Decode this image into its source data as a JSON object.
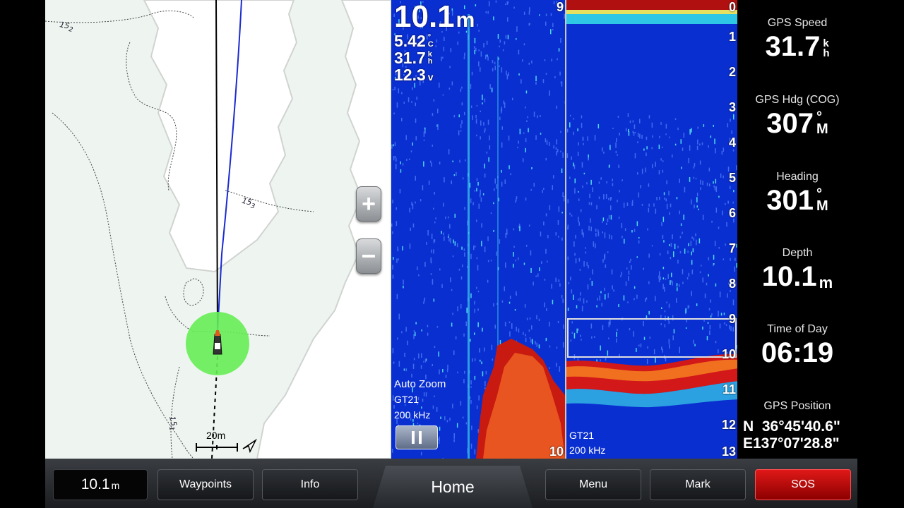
{
  "chart": {
    "contours": [
      "15",
      "15",
      "15"
    ],
    "contour_subs": [
      "2",
      "3",
      "1"
    ],
    "scale_label": "20m",
    "zoom_in_icon": "plus-icon",
    "zoom_out_icon": "minus-icon",
    "colors": {
      "water": "#eef5f0",
      "track": "#1a2bd0",
      "heading_line": "#000000",
      "position_circle": "#66ee55"
    }
  },
  "sonar_left": {
    "depth_value": "10.1",
    "depth_unit": "m",
    "temp_value": "5.42",
    "temp_unit_top": "°",
    "temp_unit_bottom": "C",
    "speed_value": "31.7",
    "speed_unit_top": "k",
    "speed_unit_bottom": "h",
    "voltage_value": "12.3",
    "voltage_unit": "v",
    "top_scale": "9",
    "bottom_scale": "10",
    "mode_label": "Auto Zoom",
    "transducer": "GT21",
    "frequency": "200 kHz",
    "pause_icon": "pause-icon"
  },
  "sonar_right": {
    "scale": [
      "0",
      "1",
      "2",
      "3",
      "4",
      "5",
      "6",
      "7",
      "8",
      "9",
      "10",
      "11",
      "12",
      "13"
    ],
    "transducer": "GT21",
    "frequency": "200 kHz"
  },
  "sidebar": {
    "gps_speed": {
      "label": "GPS Speed",
      "value": "31.7",
      "unit_top": "k",
      "unit_bottom": "h"
    },
    "gps_heading": {
      "label": "GPS Hdg (COG)",
      "value": "307",
      "unit_top": "°",
      "unit_bottom": "M"
    },
    "heading": {
      "label": "Heading",
      "value": "301",
      "unit_top": "°",
      "unit_bottom": "M"
    },
    "depth": {
      "label": "Depth",
      "value": "10.1",
      "unit": "m"
    },
    "time": {
      "label": "Time of Day",
      "value": "06:19"
    },
    "position": {
      "label": "GPS Position",
      "lat": "N  36°45'40.6\"",
      "lon": "E137°07'28.8\""
    }
  },
  "bottom_bar": {
    "depth_value": "10.1",
    "depth_unit": "m",
    "waypoints": "Waypoints",
    "info": "Info",
    "home": "Home",
    "menu": "Menu",
    "mark": "Mark",
    "sos": "SOS",
    "colors": {
      "sos": "#d01010"
    }
  }
}
